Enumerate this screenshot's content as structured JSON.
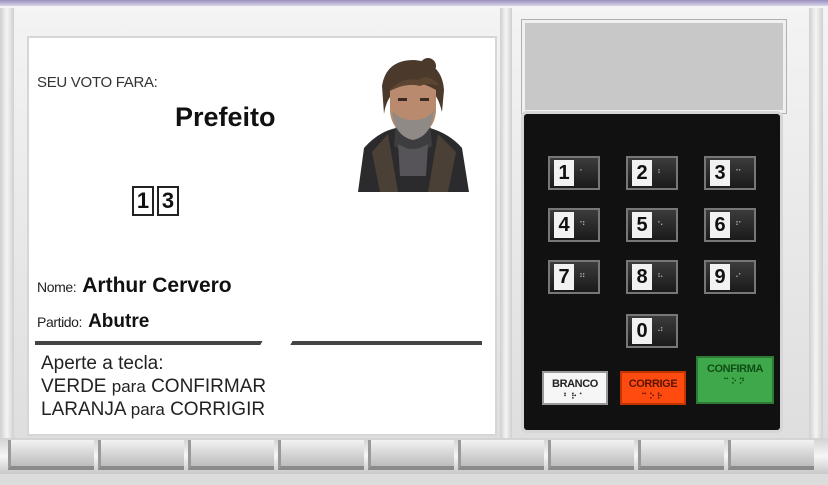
{
  "screen": {
    "label": "SEU VOTO FARA:",
    "office": "Prefeito",
    "digits": [
      "1",
      "3"
    ],
    "name_label": "Nome:",
    "name_value": "Arthur Cervero",
    "party_label": "Partido:",
    "party_value": "Abutre",
    "instructions": {
      "line1": "Aperte a tecla:",
      "line2_a": "VERDE",
      "line2_b": "para",
      "line2_c": "CONFIRMAR",
      "line3_a": "LARANJA",
      "line3_b": "para",
      "line3_c": "CORRIGIR"
    }
  },
  "keypad": {
    "keys": [
      "1",
      "2",
      "3",
      "4",
      "5",
      "6",
      "7",
      "8",
      "9",
      "0"
    ],
    "branco_label": "BRANCO",
    "corrige_label": "CORRIGE",
    "confirma_label": "CONFIRMA"
  },
  "colors": {
    "branco": "#f6f6f6",
    "corrige": "#ff4a10",
    "confirma": "#3fa84a"
  },
  "icons": {
    "candidate_photo": "candidate-portrait-bearded-man"
  }
}
